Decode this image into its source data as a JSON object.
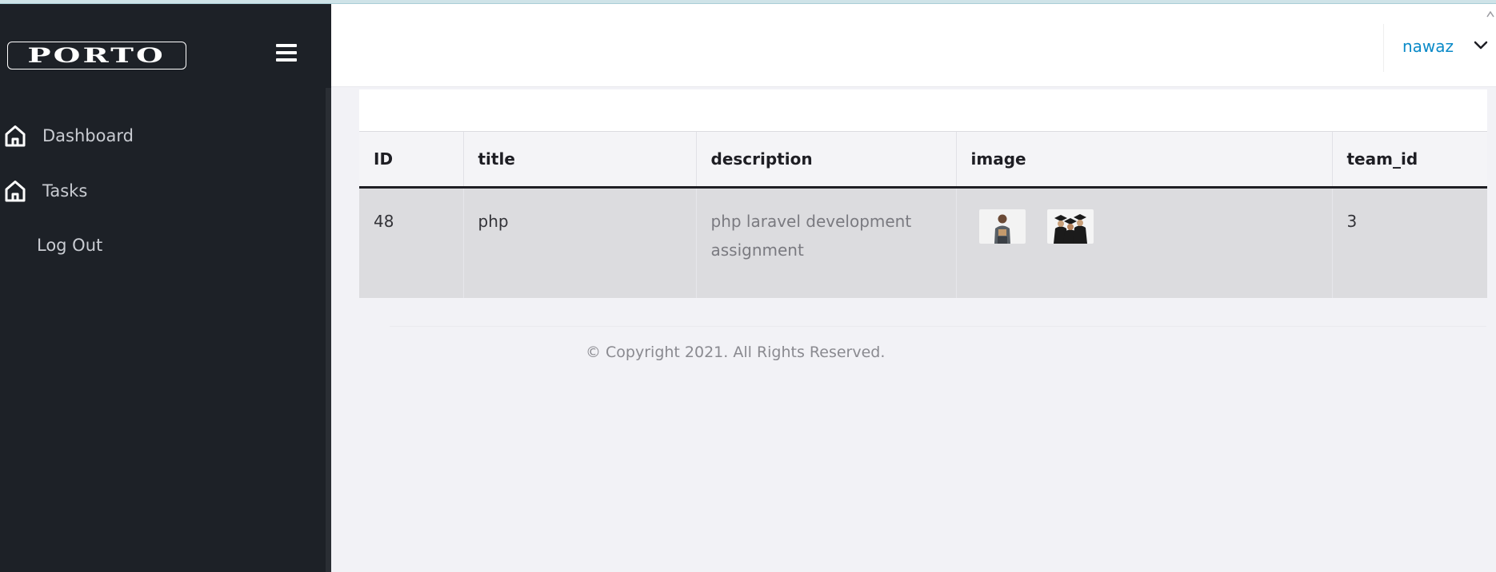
{
  "app": {
    "logo_text": "PORTO"
  },
  "sidebar": {
    "items": [
      {
        "label": "Dashboard",
        "icon": "home-icon"
      },
      {
        "label": "Tasks",
        "icon": "home-icon"
      },
      {
        "label": "Log Out"
      }
    ]
  },
  "header": {
    "user_name": "nawaz"
  },
  "table": {
    "columns": [
      "ID",
      "title",
      "description",
      "image",
      "team_id"
    ],
    "rows": [
      {
        "id": "48",
        "title": "php",
        "description": "php laravel development assignment",
        "images": [
          "student-photo",
          "graduates-photo"
        ],
        "team_id": "3"
      }
    ]
  },
  "footer": {
    "copyright": "© Copyright 2021. All Rights Reserved."
  },
  "colors": {
    "sidebar_bg": "#1d2127",
    "accent": "#0a8ac8",
    "page_bg": "#f2f2f6"
  }
}
